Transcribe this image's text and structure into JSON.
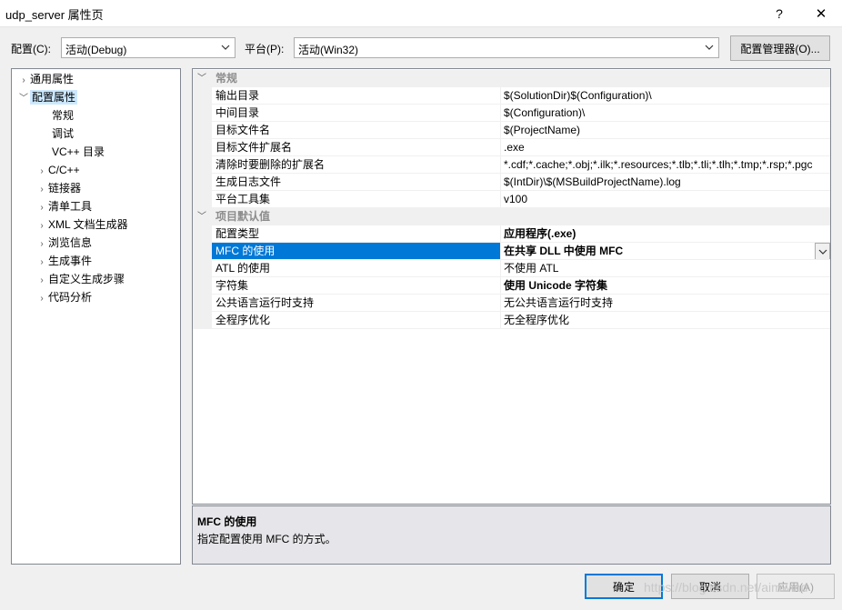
{
  "window": {
    "title": "udp_server 属性页",
    "help": "?",
    "close": "✕"
  },
  "toolbar": {
    "config_label": "配置(C):",
    "config_value": "活动(Debug)",
    "platform_label": "平台(P):",
    "platform_value": "活动(Win32)",
    "config_manager": "配置管理器(O)..."
  },
  "tree": [
    {
      "label": "通用属性",
      "expander": "right"
    },
    {
      "label": "配置属性",
      "expander": "down",
      "selected": true
    },
    {
      "label": "常规"
    },
    {
      "label": "调试"
    },
    {
      "label": "VC++ 目录"
    },
    {
      "label": "C/C++",
      "expander": "right"
    },
    {
      "label": "链接器",
      "expander": "right"
    },
    {
      "label": "清单工具",
      "expander": "right"
    },
    {
      "label": "XML 文档生成器",
      "expander": "right"
    },
    {
      "label": "浏览信息",
      "expander": "right"
    },
    {
      "label": "生成事件",
      "expander": "right"
    },
    {
      "label": "自定义生成步骤",
      "expander": "right"
    },
    {
      "label": "代码分析",
      "expander": "right"
    }
  ],
  "grid": {
    "cat1": "常规",
    "general": [
      {
        "name": "输出目录",
        "value": "$(SolutionDir)$(Configuration)\\"
      },
      {
        "name": "中间目录",
        "value": "$(Configuration)\\"
      },
      {
        "name": "目标文件名",
        "value": "$(ProjectName)"
      },
      {
        "name": "目标文件扩展名",
        "value": ".exe"
      },
      {
        "name": "清除时要删除的扩展名",
        "value": "*.cdf;*.cache;*.obj;*.ilk;*.resources;*.tlb;*.tli;*.tlh;*.tmp;*.rsp;*.pgc"
      },
      {
        "name": "生成日志文件",
        "value": "$(IntDir)\\$(MSBuildProjectName).log"
      },
      {
        "name": "平台工具集",
        "value": "v100"
      }
    ],
    "cat2": "项目默认值",
    "defaults": [
      {
        "name": "配置类型",
        "value": "应用程序(.exe)",
        "bold": true
      },
      {
        "name": "MFC 的使用",
        "value": "在共享 DLL 中使用 MFC",
        "bold": true,
        "selected": true
      },
      {
        "name": "ATL 的使用",
        "value": "不使用 ATL"
      },
      {
        "name": "字符集",
        "value": "使用 Unicode 字符集",
        "bold": true
      },
      {
        "name": "公共语言运行时支持",
        "value": "无公共语言运行时支持"
      },
      {
        "name": "全程序优化",
        "value": "无全程序优化"
      }
    ]
  },
  "description": {
    "title": "MFC 的使用",
    "text": "指定配置使用 MFC 的方式。"
  },
  "buttons": {
    "ok": "确定",
    "cancel": "取消",
    "apply": "应用(A)"
  },
  "watermark": "https://blog.csdn.net/aimwind",
  "colors": {
    "accent": "#0078d7",
    "tree_selected": "#cce8ff",
    "desc_bg": "#e6e6ea"
  }
}
